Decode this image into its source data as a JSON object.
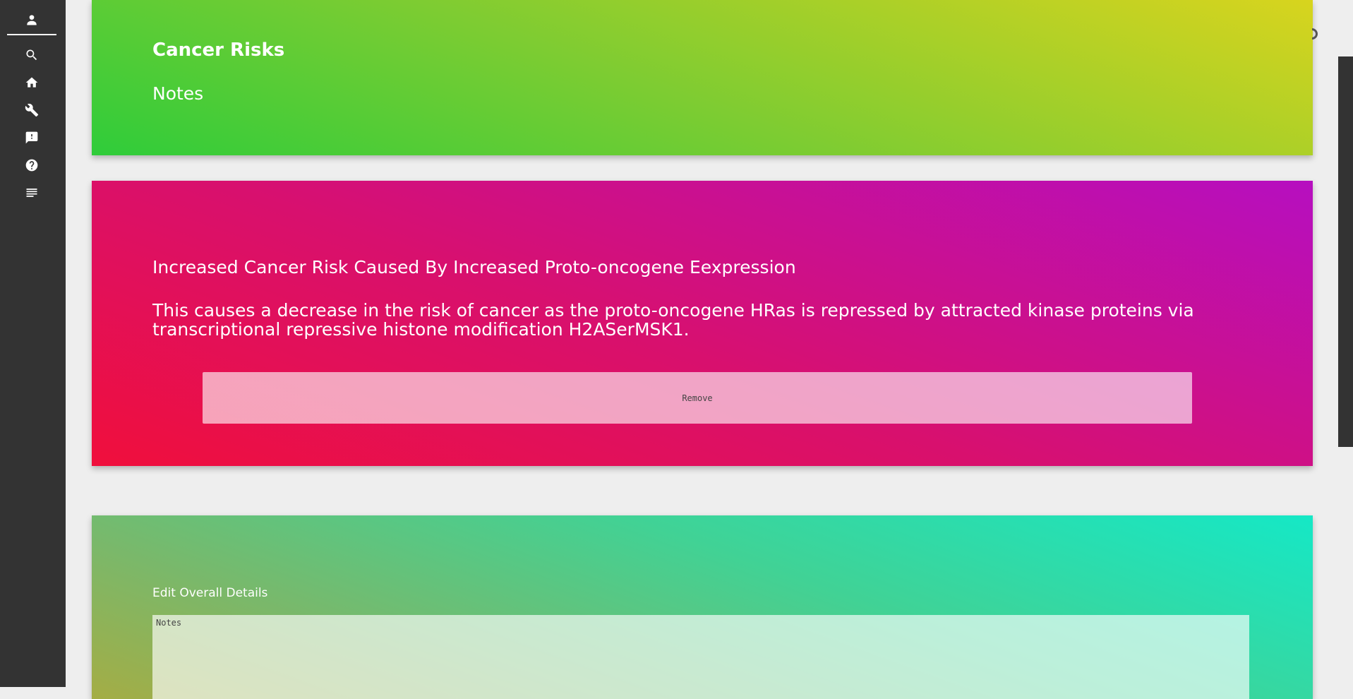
{
  "sidebar": {
    "items": [
      {
        "icon": "person-icon",
        "name": "sidebar-item-profile"
      },
      {
        "icon": "search-icon",
        "name": "sidebar-item-search"
      },
      {
        "icon": "home-icon",
        "name": "sidebar-item-home"
      },
      {
        "icon": "wrench-icon",
        "name": "sidebar-item-tools"
      },
      {
        "icon": "feedback-icon",
        "name": "sidebar-item-feedback"
      },
      {
        "icon": "help-icon",
        "name": "sidebar-item-help"
      },
      {
        "icon": "notes-icon",
        "name": "sidebar-item-notes"
      }
    ]
  },
  "header_card": {
    "title": "Cancer Risks",
    "subtitle": "Notes"
  },
  "risk_card": {
    "title": "Increased Cancer Risk Caused By Increased Proto-oncogene Eexpression",
    "description": "This causes a decrease in the risk of cancer as the proto-oncogene HRas is repressed by attracted kinase proteins via transcriptional repressive histone modification H2ASerMSK1.",
    "remove_label": "Remove"
  },
  "edit_card": {
    "label": "Edit Overall Details",
    "notes_placeholder": "Notes"
  },
  "colors": {
    "sidebar": "#333333",
    "background": "#eeeeee",
    "green_gradient": [
      "#2fcc3a",
      "#d8d41e"
    ],
    "pink_gradient": [
      "#f00f3c",
      "#b60fc0"
    ],
    "teal_gradient": [
      "#a4ad45",
      "#15e8c6"
    ]
  }
}
